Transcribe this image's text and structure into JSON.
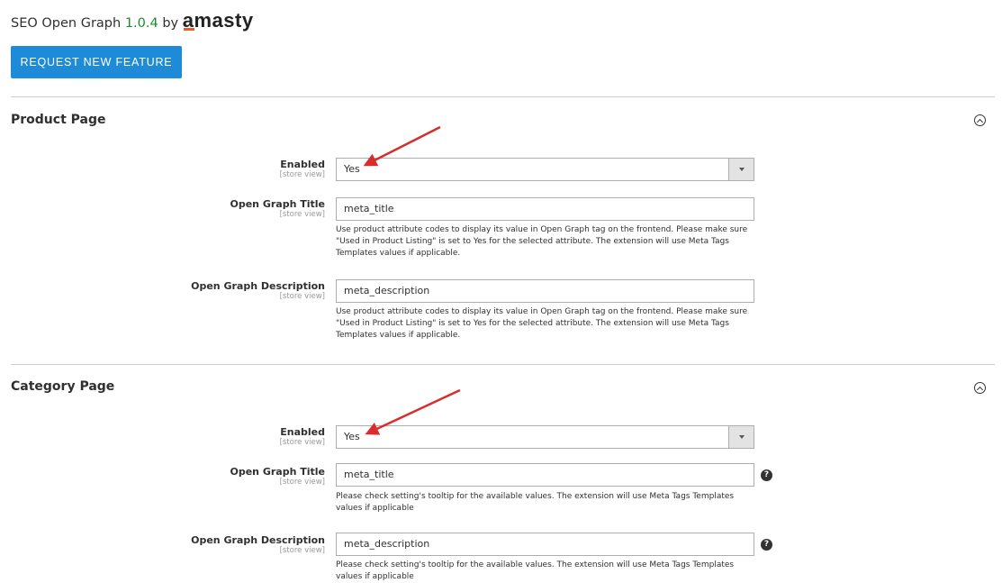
{
  "header": {
    "title": "SEO Open Graph",
    "version": "1.0.4",
    "by": "by",
    "brand": "amasty",
    "request_button": "REQUEST NEW FEATURE"
  },
  "colors": {
    "accent": "#1e8bd8",
    "version": "#1e8a2e",
    "brand_mark": "#ef5a2a",
    "annotation_arrow": "#d92d2d"
  },
  "sections": {
    "product": {
      "title": "Product Page",
      "enabled_label": "Enabled",
      "enabled_scope": "[store view]",
      "enabled_value": "Yes",
      "og_title_label": "Open Graph Title",
      "og_title_scope": "[store view]",
      "og_title_value": "meta_title",
      "og_title_note": "Use product attribute codes to display its value in Open Graph tag on the frontend. Please make sure \"Used in Product Listing\" is set to Yes for the selected attribute. The extension will use Meta Tags Templates values if applicable.",
      "og_desc_label": "Open Graph Description",
      "og_desc_scope": "[store view]",
      "og_desc_value": "meta_description",
      "og_desc_note": "Use product attribute codes to display its value in Open Graph tag on the frontend. Please make sure \"Used in Product Listing\" is set to Yes for the selected attribute. The extension will use Meta Tags Templates values if applicable."
    },
    "category": {
      "title": "Category Page",
      "enabled_label": "Enabled",
      "enabled_scope": "[store view]",
      "enabled_value": "Yes",
      "og_title_label": "Open Graph Title",
      "og_title_scope": "[store view]",
      "og_title_value": "meta_title",
      "og_title_note": "Please check setting's tooltip for the available values. The extension will use Meta Tags Templates values if applicable",
      "og_desc_label": "Open Graph Description",
      "og_desc_scope": "[store view]",
      "og_desc_value": "meta_description",
      "og_desc_note": "Please check setting's tooltip for the available values. The extension will use Meta Tags Templates values if applicable",
      "help_glyph": "?"
    }
  }
}
